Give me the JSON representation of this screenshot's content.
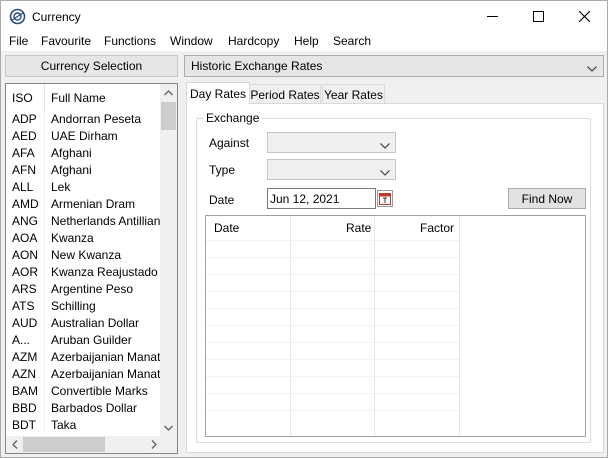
{
  "window": {
    "title": "Currency"
  },
  "menu": [
    "File",
    "Favourite",
    "Functions",
    "Window",
    "Hardcopy",
    "Help",
    "Search"
  ],
  "left": {
    "selection_button": "Currency Selection",
    "columns": {
      "iso": "ISO",
      "full": "Full Name"
    },
    "rows": [
      {
        "iso": "ADP",
        "name": "Andorran Peseta"
      },
      {
        "iso": "AED",
        "name": "UAE Dirham"
      },
      {
        "iso": "AFA",
        "name": "Afghani"
      },
      {
        "iso": "AFN",
        "name": "Afghani"
      },
      {
        "iso": "ALL",
        "name": "Lek"
      },
      {
        "iso": "AMD",
        "name": "Armenian Dram"
      },
      {
        "iso": "ANG",
        "name": "Netherlands Antillian ..."
      },
      {
        "iso": "AOA",
        "name": "Kwanza"
      },
      {
        "iso": "AON",
        "name": "New Kwanza"
      },
      {
        "iso": "AOR",
        "name": "Kwanza Reajustado"
      },
      {
        "iso": "ARS",
        "name": "Argentine Peso"
      },
      {
        "iso": "ATS",
        "name": "Schilling"
      },
      {
        "iso": "AUD",
        "name": "Australian Dollar"
      },
      {
        "iso": "A...",
        "name": "Aruban Guilder"
      },
      {
        "iso": "AZM",
        "name": "Azerbaijanian Manat"
      },
      {
        "iso": "AZN",
        "name": "Azerbaijanian Manat"
      },
      {
        "iso": "BAM",
        "name": "Convertible Marks"
      },
      {
        "iso": "BBD",
        "name": "Barbados Dollar"
      },
      {
        "iso": "BDT",
        "name": "Taka"
      }
    ]
  },
  "right": {
    "view_dropdown": "Historic Exchange Rates",
    "tabs": [
      "Day Rates",
      "Period Rates",
      "Year Rates"
    ],
    "active_tab": "Day Rates",
    "group_title": "Exchange",
    "against_label": "Against",
    "against_value": "",
    "type_label": "Type",
    "type_value": "",
    "date_label": "Date",
    "date_value": "Jun 12, 2021",
    "find_button": "Find Now",
    "grid_columns": [
      "Date",
      "Rate",
      "Factor"
    ]
  },
  "colors": {
    "window_bg": "#f0f0f0",
    "panel_bg": "#ffffff",
    "border": "#828790"
  }
}
